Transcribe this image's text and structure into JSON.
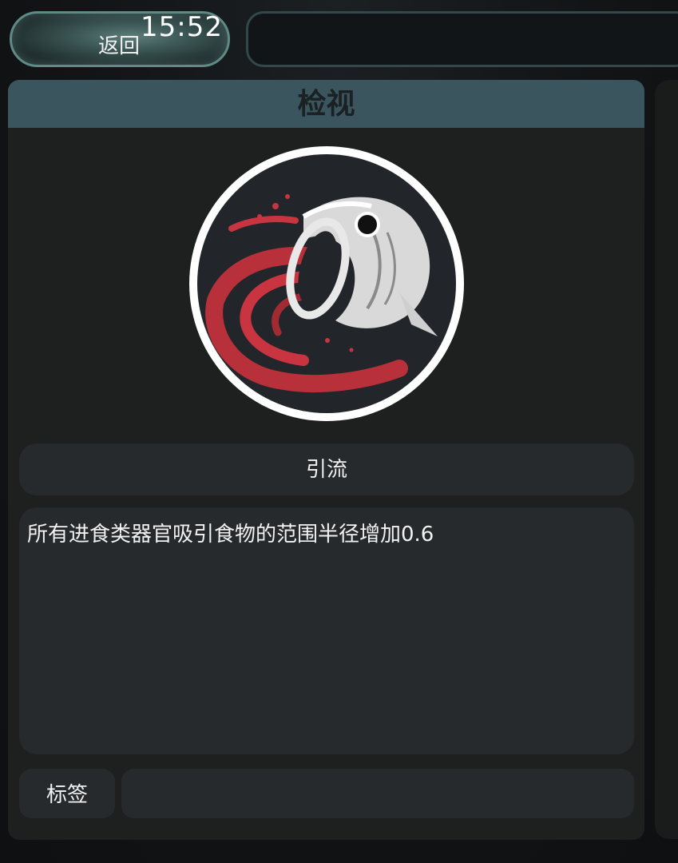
{
  "status_bar": {
    "time": "15:52"
  },
  "header": {
    "back_label": "返回",
    "top_bar_text": ""
  },
  "panel": {
    "title": "检视",
    "icon": "fish-attract-icon",
    "trait_name": "引流",
    "description": "所有进食类器官吸引食物的范围半径增加0.6",
    "tags_label": "标签",
    "tags_value": ""
  },
  "colors": {
    "header_bg": "#3a555d",
    "panel_bg": "#1e1f1f",
    "box_bg": "#272a2d",
    "accent_red": "#c8343f",
    "button_border": "#5e8b86"
  }
}
